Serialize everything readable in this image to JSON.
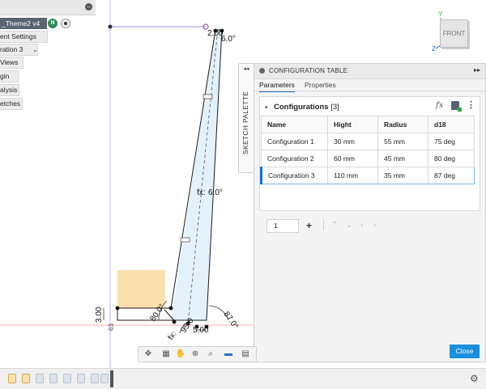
{
  "browser": {
    "document_name": "_Theme2 v4",
    "badge": "N",
    "items": [
      "ent Settings",
      "ration 3",
      "Views",
      "gin",
      "alysis",
      "etches"
    ]
  },
  "viewcube": {
    "face": "FRONT"
  },
  "axes": {
    "y": "Y",
    "x": "X",
    "z": "Z"
  },
  "sketch": {
    "dimensions": {
      "top_width": "2.00",
      "top_angle": "6.0°",
      "mid_angle": "6.0°",
      "mid_angle_prefix": "fx:",
      "left_angle": "80.0°",
      "right_angle": "87.0°",
      "bottom_angle_prefix": "fx:",
      "bottom_angle": "95.0",
      "bottom_width": "5.00",
      "left_height": "3.00",
      "small_label": "63"
    }
  },
  "palette": {
    "label": "SKETCH PALETTE",
    "arrow": "◂◂"
  },
  "config_table": {
    "title": "CONFIGURATION TABLE",
    "expand": "▸▸",
    "tabs": [
      "Parameters",
      "Properties"
    ],
    "section_title": "Configurations",
    "section_count": "[3]",
    "fx_label": "fx",
    "columns": [
      "Name",
      "Hight",
      "Radius",
      "d18"
    ],
    "rows": [
      [
        "Configuration 1",
        "30 mm",
        "55 mm",
        "75 deg"
      ],
      [
        "Configuration 2",
        "60 mm",
        "45 mm",
        "80 deg"
      ],
      [
        "Configuration 3",
        "110 mm",
        "35 mm",
        "87 deg"
      ]
    ],
    "active_row": 2,
    "page_value": "1",
    "add_label": "+",
    "close_label": "Close",
    "accent_color": "#1a73c9"
  },
  "navbar": {
    "icons": [
      "orbit-icon",
      "look-at-icon",
      "pan-icon",
      "zoom-window-icon",
      "zoom-icon",
      "display-settings-icon",
      "grid-icon"
    ]
  },
  "timeline": {
    "items": 9,
    "settings_icon": "gear-icon"
  }
}
